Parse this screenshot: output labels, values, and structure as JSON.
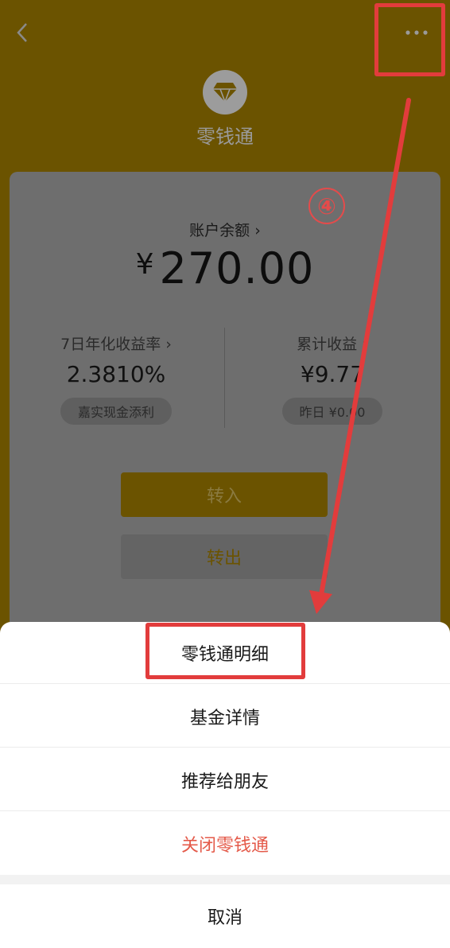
{
  "header": {
    "back_icon": "chevron-left-icon",
    "more_icon": "more-dots-icon",
    "logo_icon": "diamond-icon",
    "title": "零钱通"
  },
  "balance": {
    "label": "账户余额 ›",
    "currency": "¥",
    "amount": "270.00"
  },
  "stats": {
    "rate_label": "7日年化收益率 ›",
    "rate_value": "2.3810%",
    "rate_fund": "嘉实现金添利",
    "earn_label": "累计收益 ›",
    "earn_value": "¥9.77",
    "earn_yesterday": "昨日 ¥0.00"
  },
  "actions": {
    "transfer_in": "转入",
    "transfer_out": "转出"
  },
  "annotation": {
    "step": "④",
    "color": "#e23c3c"
  },
  "sheet": {
    "items": [
      {
        "label": "零钱通明细"
      },
      {
        "label": "基金详情"
      },
      {
        "label": "推荐给朋友"
      },
      {
        "label": "关闭零钱通"
      }
    ],
    "cancel": "取消"
  },
  "colors": {
    "brand_dimmed": "#6b5300",
    "danger": "#e45a4a"
  }
}
